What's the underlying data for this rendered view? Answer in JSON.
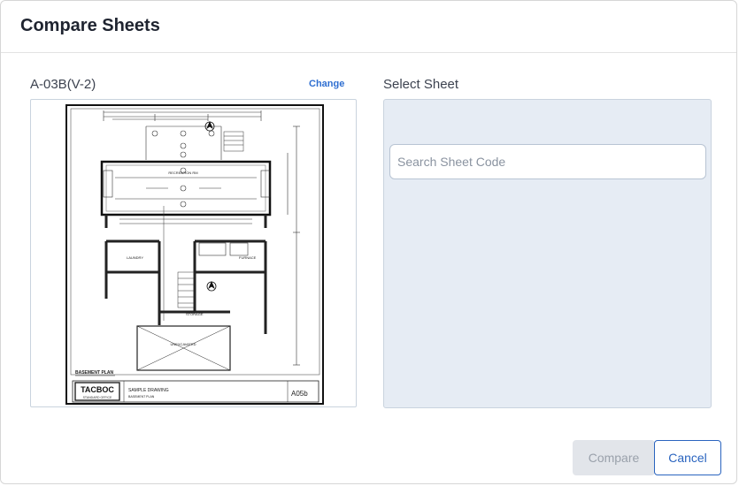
{
  "dialog": {
    "title": "Compare Sheets"
  },
  "left_panel": {
    "sheet_title": "A-03B(V-2)",
    "change_label": "Change",
    "drawing": {
      "room_labels": [
        "RECREATION RM",
        "LAUNDRY",
        "FURNACE",
        "STORAGE",
        "UNEXCAVATED"
      ],
      "plan_title": "BASEMENT PLAN",
      "logo_text": "TACBOC",
      "logo_subtext": "STANDARD OFFICE",
      "drawing_title": "SAMPLE DRAWING",
      "drawing_subtitle": "BASEMENT PLAN",
      "sheet_number": "A05b"
    }
  },
  "right_panel": {
    "title": "Select Sheet",
    "search_placeholder": "Search Sheet Code"
  },
  "footer": {
    "compare_label": "Compare",
    "cancel_label": "Cancel"
  },
  "colors": {
    "link": "#2f6fd1",
    "cancel_border": "#2a64bf",
    "panel_bg": "#e6ecf4",
    "disabled_bg": "#e2e5ea"
  }
}
